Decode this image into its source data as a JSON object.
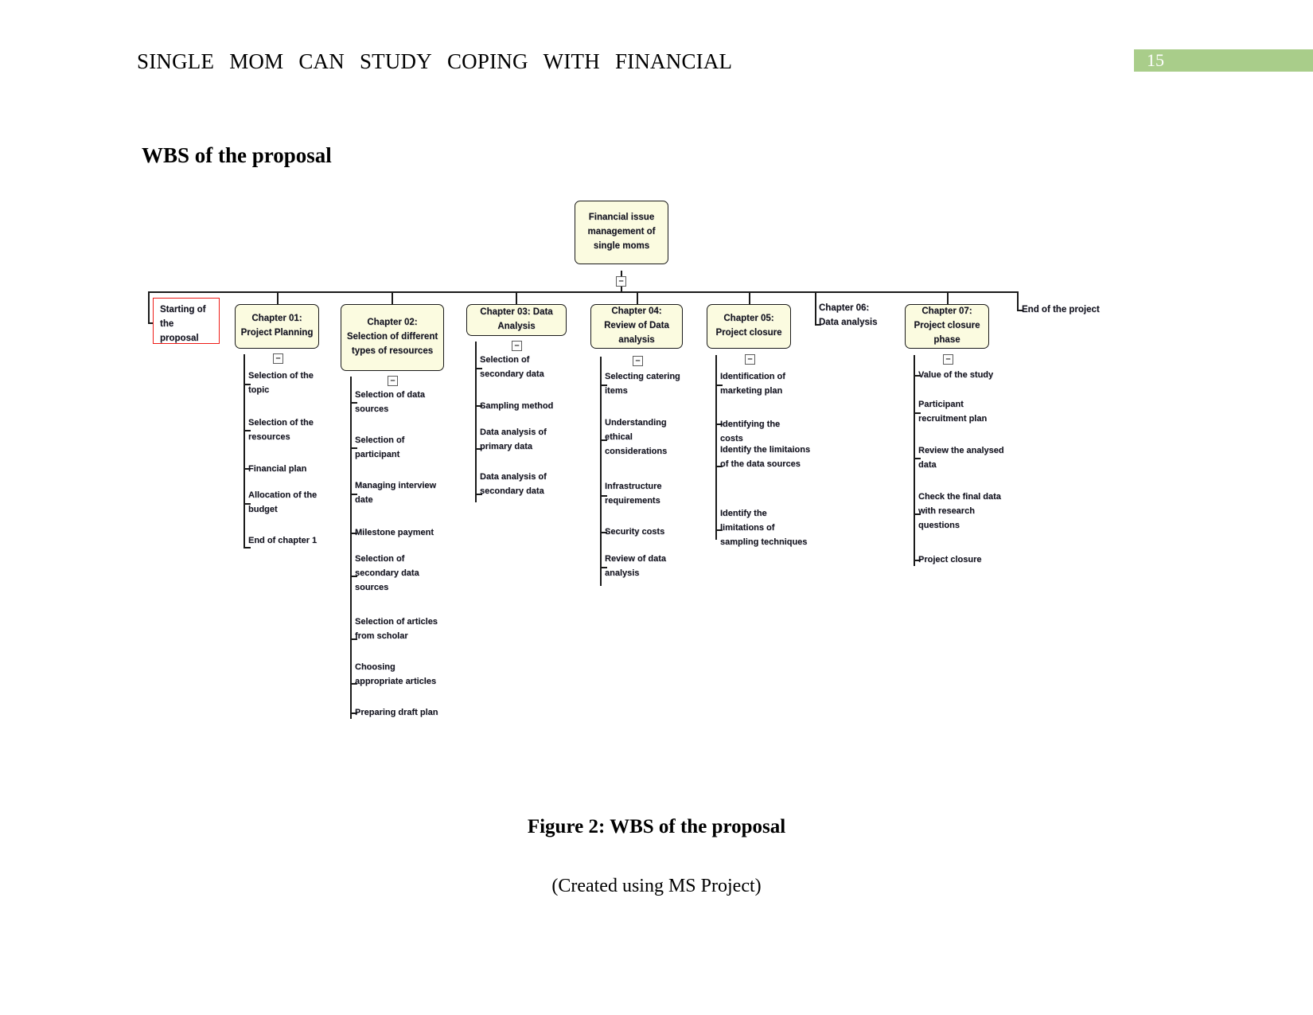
{
  "header": {
    "running_head": "SINGLE MOM CAN STUDY COPING WITH FINANCIAL",
    "running_head_words": [
      "SINGLE",
      "MOM",
      "CAN",
      "STUDY",
      "COPING",
      "WITH",
      "FINANCIAL"
    ],
    "page_number": "15",
    "badge_color": "#a9cd8a"
  },
  "section": {
    "title": "WBS of the proposal"
  },
  "figure": {
    "caption": "Figure 2: WBS of the proposal",
    "source": "(Created using MS Project)",
    "node_fill": "#fbfbe0",
    "node_shadow": "#ee1b16",
    "node_border": "#1a1a1a",
    "collapse_symbol": "–"
  },
  "chart_data": {
    "type": "diagram",
    "diagram_type": "work-breakdown-structure",
    "title": "WBS of the proposal",
    "root": "Financial issue management of single moms",
    "nodes": [
      {
        "id": "start",
        "label": "Starting of the proposal",
        "style": "red-outline",
        "children": []
      },
      {
        "id": "ch01",
        "label": "Chapter 01: Project Planning",
        "style": "box",
        "children": [
          "Selection of the topic",
          "Selection of the resources",
          "Financial plan",
          "Allocation of the budget",
          "End of chapter 1"
        ]
      },
      {
        "id": "ch02",
        "label": "Chapter 02: Selection of different types of resources",
        "style": "box",
        "children": [
          "Selection of data sources",
          "Selection of participant",
          "Managing interview date",
          "Milestone payment",
          "Selection of secondary data sources",
          "Selection of articles from scholar",
          "Choosing appropriate articles",
          "Preparing draft plan"
        ]
      },
      {
        "id": "ch03",
        "label": "Chapter 03: Data Analysis",
        "style": "box",
        "children": [
          "Selection of secondary data",
          "Sampling method",
          "Data analysis of primary data",
          "Data analysis of secondary data"
        ]
      },
      {
        "id": "ch04",
        "label": "Chapter 04: Review of Data analysis",
        "style": "box",
        "children": [
          "Selecting catering items",
          "Understanding ethical considerations",
          "Infrastructure requirements",
          "Security costs",
          "Review of data analysis"
        ]
      },
      {
        "id": "ch05",
        "label": "Chapter 05: Project closure",
        "style": "box",
        "children": [
          "Identification of marketing plan",
          "Identifying the costs",
          "Identify the limitaions of the data sources",
          "Identify the limitations of sampling techniques"
        ]
      },
      {
        "id": "ch06",
        "label": "Chapter 06: Data analysis",
        "style": "plain",
        "children": []
      },
      {
        "id": "ch07",
        "label": "Chapter 07: Project closure phase",
        "style": "box",
        "children": [
          "Value of the study",
          "Participant recruitment plan",
          "Review the analysed data",
          "Check the final data with research questions",
          "Project closure"
        ]
      },
      {
        "id": "end",
        "label": "End of the project",
        "style": "plain",
        "children": []
      }
    ]
  }
}
